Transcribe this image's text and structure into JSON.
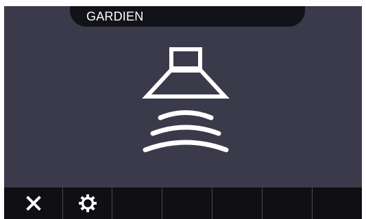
{
  "header": {
    "title": "GARDIEN"
  },
  "icons": {
    "center": "speaker-sound-waves-icon",
    "close": "close-icon",
    "settings": "gear-icon"
  },
  "colors": {
    "screen_bg": "#3a3a4b",
    "bar_bg": "#0f0f14",
    "foreground": "#ffffff"
  },
  "toolbar": {
    "buttons": [
      "close",
      "settings",
      "",
      "",
      "",
      "",
      ""
    ]
  }
}
